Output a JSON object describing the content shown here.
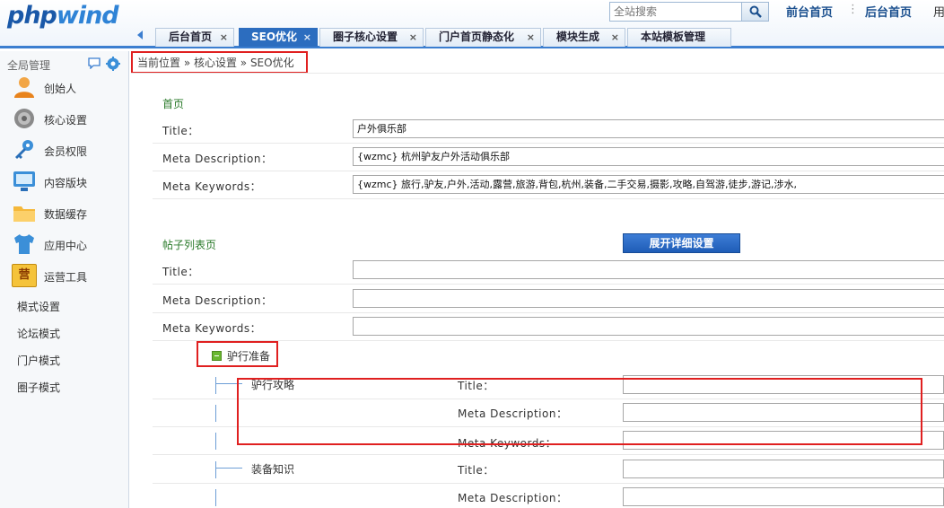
{
  "header": {
    "logo_main": "php",
    "logo_accent": "wind",
    "search_placeholder": "全站搜索",
    "links": {
      "front": "前台首页",
      "sep": "⋮",
      "back": "后台首页",
      "user": "用"
    }
  },
  "tabs": [
    {
      "label": "后台首页",
      "close": "×",
      "active": false
    },
    {
      "label": "SEO优化",
      "close": "×",
      "active": true
    },
    {
      "label": "圈子核心设置",
      "close": "×",
      "active": false
    },
    {
      "label": "门户首页静态化",
      "close": "×",
      "active": false
    },
    {
      "label": "模块生成",
      "close": "×",
      "active": false
    },
    {
      "label": "本站模板管理",
      "close": "×",
      "active": false
    }
  ],
  "sidebar": {
    "title": "全局管理",
    "items": [
      {
        "label": "创始人",
        "icon": "user-icon"
      },
      {
        "label": "核心设置",
        "icon": "disc-icon"
      },
      {
        "label": "会员权限",
        "icon": "key-icon"
      },
      {
        "label": "内容版块",
        "icon": "monitor-icon"
      },
      {
        "label": "数据缓存",
        "icon": "folder-icon"
      },
      {
        "label": "应用中心",
        "icon": "shirt-icon"
      },
      {
        "label": "运营工具",
        "icon": "shop-icon",
        "badge": "营"
      }
    ],
    "sub_items": [
      "模式设置",
      "论坛模式",
      "门户模式",
      "圈子模式"
    ]
  },
  "breadcrumb": "当前位置 » 核心设置 » SEO优化",
  "homepage": {
    "title": "首页",
    "rows": [
      {
        "label": "Title：",
        "value": "户外俱乐部"
      },
      {
        "label": "Meta Description：",
        "value": "{wzmc} 杭州驴友户外活动俱乐部"
      },
      {
        "label": "Meta Keywords：",
        "value": "{wzmc} 旅行,驴友,户外,活动,露营,旅游,背包,杭州,装备,二手交易,摄影,攻略,自驾游,徒步,游记,涉水,"
      }
    ]
  },
  "thread_list": {
    "title": "帖子列表页",
    "expand_button": "展开详细设置",
    "rows": [
      {
        "label": "Title：",
        "value": ""
      },
      {
        "label": "Meta Description：",
        "value": ""
      },
      {
        "label": "Meta Keywords：",
        "value": ""
      }
    ]
  },
  "category": {
    "label": "驴行准备",
    "subs": [
      {
        "name": "驴行攻略",
        "fields": [
          "Title：",
          "Meta Description：",
          "Meta Keywords："
        ]
      },
      {
        "name": "装备知识",
        "fields": [
          "Title：",
          "Meta Description："
        ]
      }
    ]
  },
  "colors": {
    "accent": "#2c6dbf",
    "highlight": "#e02020",
    "section_title": "#2a7a2a"
  }
}
